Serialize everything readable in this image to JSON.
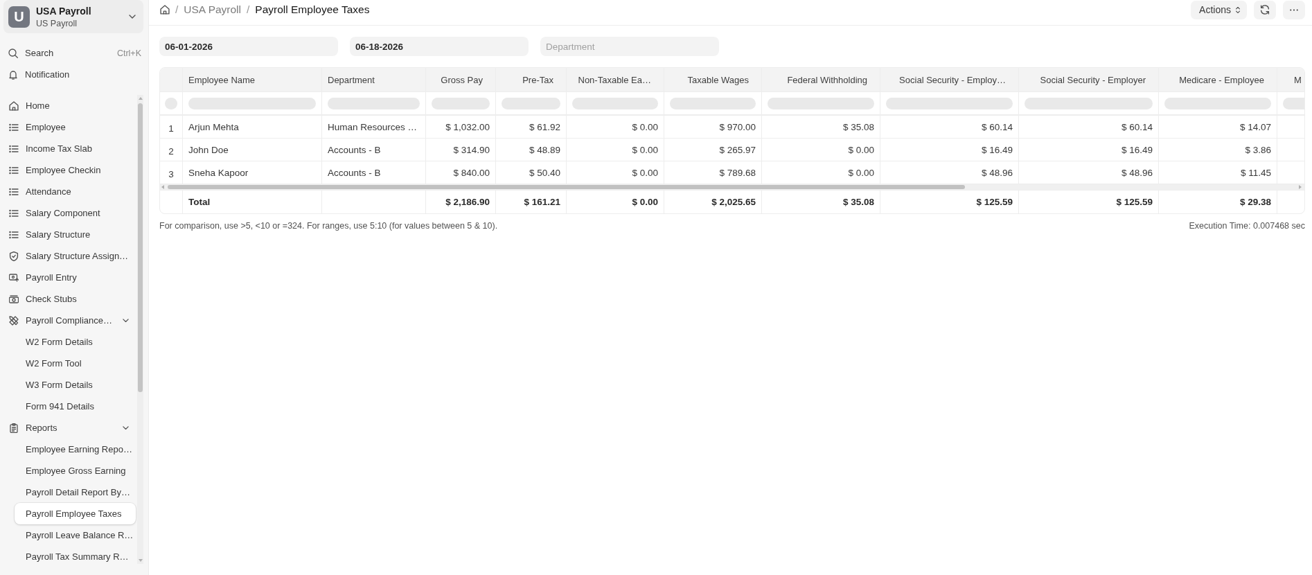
{
  "workspace": {
    "initial": "U",
    "title": "USA Payroll",
    "subtitle": "US Payroll"
  },
  "sidebar": {
    "search": {
      "label": "Search",
      "shortcut": "Ctrl+K"
    },
    "notification": {
      "label": "Notification"
    },
    "items": [
      {
        "kind": "home",
        "label": "Home",
        "selected": false
      },
      {
        "kind": "list",
        "label": "Employee",
        "selected": false
      },
      {
        "kind": "list",
        "label": "Income Tax Slab",
        "selected": false
      },
      {
        "kind": "list",
        "label": "Employee Checkin",
        "selected": false
      },
      {
        "kind": "list",
        "label": "Attendance",
        "selected": false
      },
      {
        "kind": "list",
        "label": "Salary Component",
        "selected": false
      },
      {
        "kind": "list",
        "label": "Salary Structure",
        "selected": false
      },
      {
        "kind": "assignment",
        "label": "Salary Structure Assign…",
        "selected": false
      },
      {
        "kind": "entry",
        "label": "Payroll Entry",
        "selected": false
      },
      {
        "kind": "stubs",
        "label": "Check Stubs",
        "selected": false
      },
      {
        "kind": "compliance",
        "label": "Payroll Compliance…",
        "selected": false,
        "expanded": true,
        "children": [
          {
            "label": "W2 Form Details",
            "selected": false
          },
          {
            "label": "W2 Form Tool",
            "selected": false
          },
          {
            "label": "W3 Form Details",
            "selected": false
          },
          {
            "label": "Form 941 Details",
            "selected": false
          }
        ]
      },
      {
        "kind": "report",
        "label": "Reports",
        "selected": false,
        "expanded": true,
        "children": [
          {
            "label": "Employee Earning Repo…",
            "selected": false
          },
          {
            "label": "Employee Gross Earning",
            "selected": false
          },
          {
            "label": "Payroll Detail Report By…",
            "selected": false
          },
          {
            "label": "Payroll Employee Taxes",
            "selected": true
          },
          {
            "label": "Payroll Leave Balance R…",
            "selected": false
          },
          {
            "label": "Payroll Tax Summary R…",
            "selected": false
          }
        ]
      }
    ]
  },
  "breadcrumb": [
    {
      "separator": "/",
      "label": "USA Payroll",
      "current": false
    },
    {
      "separator": "/",
      "label": "Payroll Employee Taxes",
      "current": true
    }
  ],
  "toolbar": {
    "actions_label": "Actions"
  },
  "filters": [
    {
      "value": "06-01-2026"
    },
    {
      "value": "06-18-2026"
    },
    {
      "placeholder": "Department"
    }
  ],
  "table": {
    "columns": [
      {
        "label": "Employee Name",
        "kind": "text"
      },
      {
        "label": "Department",
        "kind": "text"
      },
      {
        "label": "Gross Pay",
        "kind": "currency"
      },
      {
        "label": "Pre-Tax",
        "kind": "currency"
      },
      {
        "label": "Non-Taxable Ea…",
        "kind": "currency"
      },
      {
        "label": "Taxable Wages",
        "kind": "currency"
      },
      {
        "label": "Federal Withholding",
        "kind": "currency"
      },
      {
        "label": "Social Security - Employ…",
        "kind": "currency"
      },
      {
        "label": "Social Security - Employer",
        "kind": "currency"
      },
      {
        "label": "Medicare - Employee",
        "kind": "currency"
      },
      {
        "label": "M",
        "kind": "text"
      }
    ],
    "rows": [
      {
        "index": "1",
        "cells": [
          "Arjun Mehta",
          "Human Resources …",
          "$ 1,032.00",
          "$ 61.92",
          "$ 0.00",
          "$ 970.00",
          "$ 35.08",
          "$ 60.14",
          "$ 60.14",
          "$ 14.07"
        ]
      },
      {
        "index": "2",
        "cells": [
          "John Doe",
          "Accounts - B",
          "$ 314.90",
          "$ 48.89",
          "$ 0.00",
          "$ 265.97",
          "$ 0.00",
          "$ 16.49",
          "$ 16.49",
          "$ 3.86"
        ]
      },
      {
        "index": "3",
        "cells": [
          "Sneha Kapoor",
          "Accounts - B",
          "$ 840.00",
          "$ 50.40",
          "$ 0.00",
          "$ 789.68",
          "$ 0.00",
          "$ 48.96",
          "$ 48.96",
          "$ 11.45"
        ]
      }
    ],
    "totals": {
      "cells": [
        "Total",
        null,
        "$ 2,186.90",
        "$ 161.21",
        "$ 0.00",
        "$ 2,025.65",
        "$ 35.08",
        "$ 125.59",
        "$ 125.59",
        "$ 29.38"
      ]
    }
  },
  "footer": {
    "hint": "For comparison, use >5, <10 or =324. For ranges, use 5:10 (for values between 5 & 10).",
    "execution_time": "Execution Time: 0.007468 sec"
  }
}
